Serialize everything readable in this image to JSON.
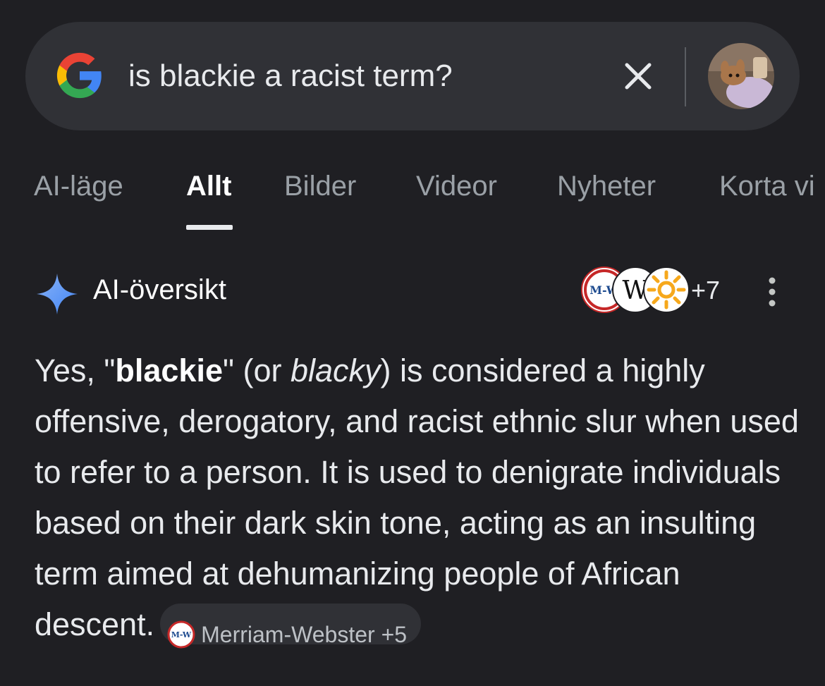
{
  "search": {
    "query": "is blackie a racist term?"
  },
  "icons": {
    "logo": "google-g-icon",
    "clear": "close-icon",
    "avatar": "profile-avatar",
    "ai": "sparkle-icon",
    "menu": "more-vert-icon"
  },
  "tabs": [
    {
      "label": "AI-läge",
      "active": false
    },
    {
      "label": "Allt",
      "active": true
    },
    {
      "label": "Bilder",
      "active": false
    },
    {
      "label": "Videor",
      "active": false
    },
    {
      "label": "Nyheter",
      "active": false
    },
    {
      "label": "Korta vi",
      "active": false
    }
  ],
  "ai_overview": {
    "title": "AI-översikt",
    "sources": {
      "icons": [
        "M-W",
        "W",
        "sun-logo"
      ],
      "more_count": "+7"
    },
    "answer": {
      "p1": "Yes, \"",
      "bold_term": "blackie",
      "p2": "\" (or ",
      "italic_term": "blacky",
      "p3": ") is considered a highly offensive, derogatory, and racist ethnic slur when used to refer to a person. It is used to denigrate individuals based on their dark skin tone, acting as an insulting term aimed at dehumanizing people of African descent.",
      "citation": {
        "icon_text": "M-W",
        "label": "Merriam-Webster +5"
      }
    }
  },
  "colors": {
    "background": "#1f1f23",
    "surface": "#303136",
    "text": "#e8eaed",
    "muted": "#9aa0a6",
    "sparkle_blue": "#4285f4"
  }
}
